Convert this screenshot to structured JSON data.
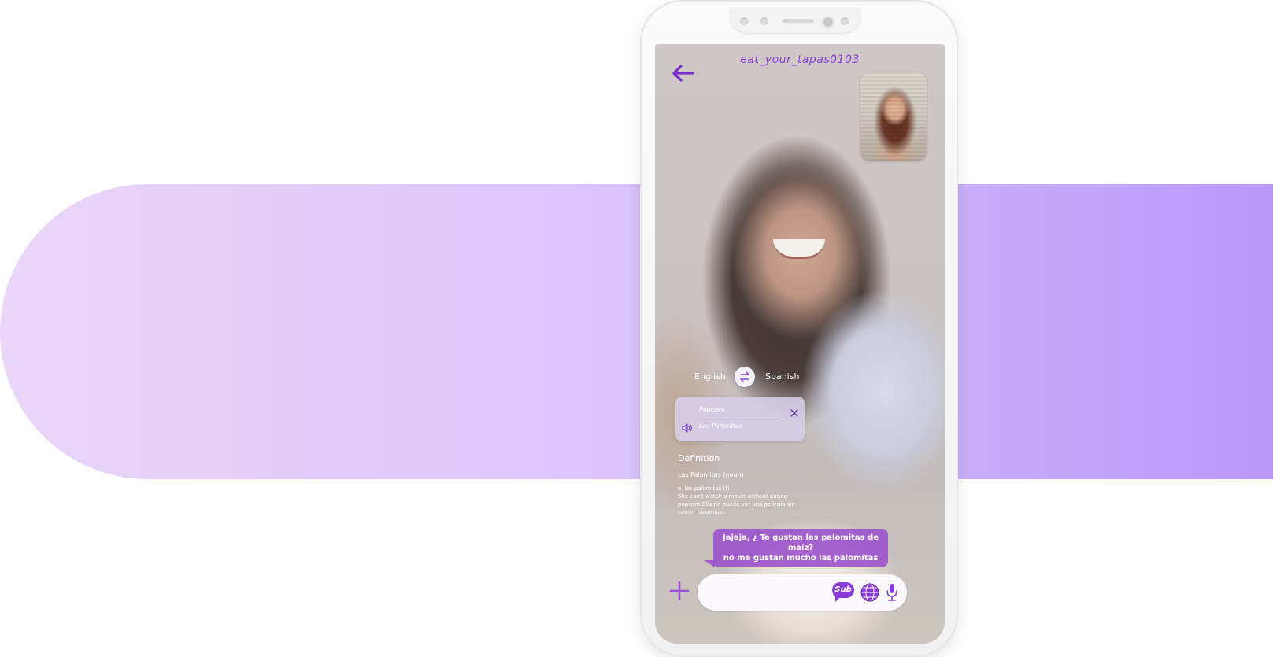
{
  "header": {
    "username": "eat_your_tapas0103"
  },
  "icons": {
    "back": "arrow-left-icon",
    "swap": "swap-arrows-icon",
    "close": "close-icon",
    "audio": "speaker-icon",
    "add": "plus-icon",
    "subtitles": "sub-bubble-icon",
    "translate": "globe-icon",
    "microphone": "microphone-icon"
  },
  "translator": {
    "source_language": "English",
    "target_language": "Spanish",
    "source_word": "Popcorn",
    "target_word": "Las Palomitas"
  },
  "definition": {
    "title": "Definition",
    "word": "Las Palomitas (noun)",
    "entry": "a. las palomitas (f)",
    "example": "She can't watch a movie without eating popcorn.Ella no puede ver una película sin comer palomitas."
  },
  "subtitle": {
    "line1": "Jajaja, ¿ Te gustan las palomitas de maíz?",
    "line2": "no me gustan mucho las palomitas"
  },
  "composer": {
    "placeholder": "",
    "sub_label": "Sub"
  },
  "colors": {
    "accent": "#8a3dd6",
    "bubble": "#9b50cd",
    "band_start": "#ead6f8",
    "band_end": "#b997f8"
  }
}
